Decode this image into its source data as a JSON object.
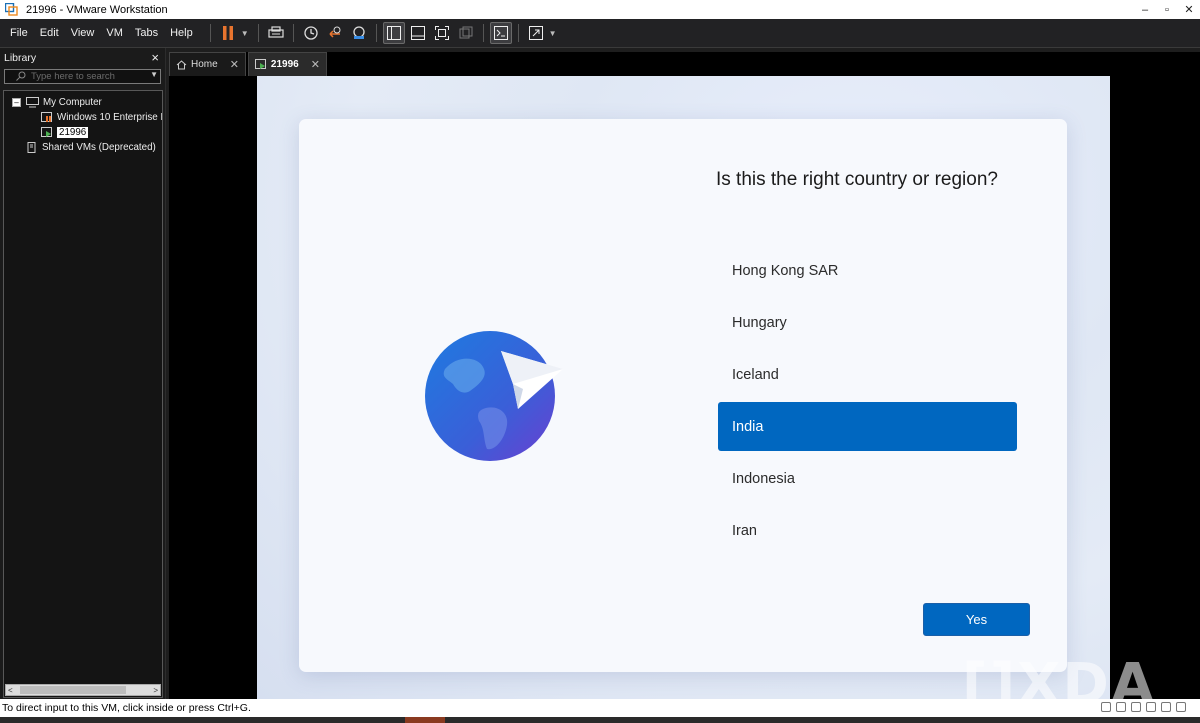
{
  "window": {
    "title": "21996 - VMware Workstation",
    "min": "–",
    "max": "▫",
    "close": "✕"
  },
  "menu": [
    "File",
    "Edit",
    "View",
    "VM",
    "Tabs",
    "Help"
  ],
  "library": {
    "title": "Library",
    "close": "×",
    "search_placeholder": "Type here to search",
    "tree": {
      "root": "My Computer",
      "items": [
        "Windows 10 Enterprise L",
        "21996"
      ],
      "shared": "Shared VMs (Deprecated)"
    }
  },
  "tabs": [
    {
      "label": "Home",
      "close": "✕"
    },
    {
      "label": "21996",
      "close": "✕"
    }
  ],
  "oobe": {
    "question": "Is this the right country or region?",
    "regions": [
      "Hong Kong SAR",
      "Hungary",
      "Iceland",
      "India",
      "Indonesia",
      "Iran"
    ],
    "selected": "India",
    "yes_label": "Yes"
  },
  "status": {
    "text": "To direct input to this VM, click inside or press Ctrl+G."
  },
  "watermark": "[]XDA",
  "colors": {
    "accent": "#0067c0",
    "pause": "#e8742e"
  }
}
